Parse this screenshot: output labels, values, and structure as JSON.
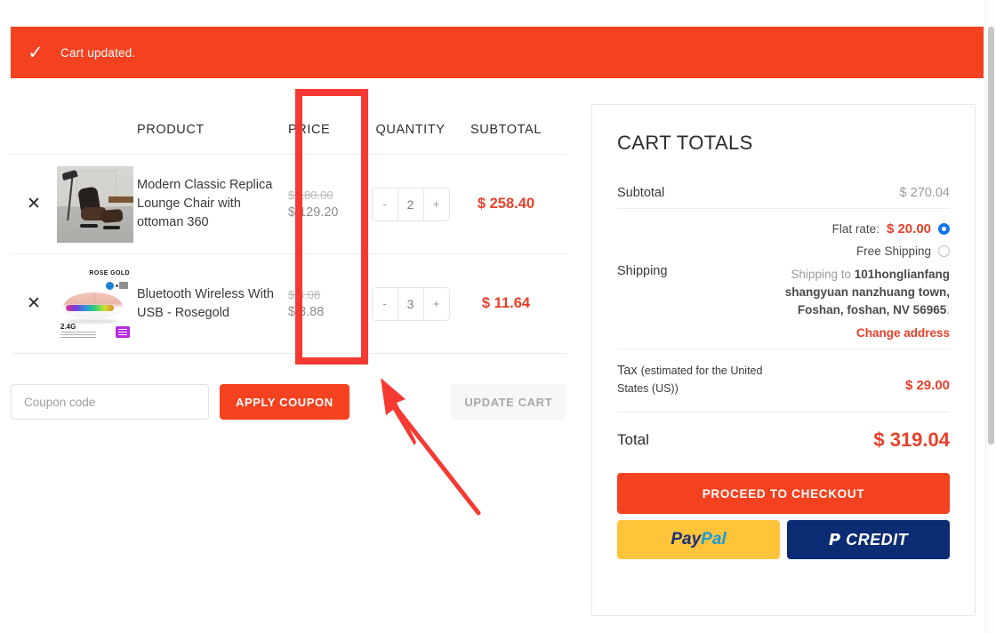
{
  "notice": {
    "icon": "check-icon",
    "text": "Cart updated."
  },
  "cart_table": {
    "headers": {
      "product": "PRODUCT",
      "price": "PRICE",
      "quantity": "QUANTITY",
      "subtotal": "SUBTOTAL"
    },
    "rows": [
      {
        "remove_icon": "close-icon",
        "thumb": "lounge-chair-photo",
        "name": "Modern Classic Replica Lounge Chair with ottoman 360",
        "price_old": "$ 180.00",
        "price_new": "$ 129.20",
        "qty_minus": "-",
        "qty": "2",
        "qty_plus": "+",
        "subtotal": "$ 258.40"
      },
      {
        "remove_icon": "close-icon",
        "thumb": "wireless-mouse-photo",
        "name": "Bluetooth Wireless With USB - Rosegold",
        "price_old": "$ 4.08",
        "price_new": "$ 3.88",
        "qty_minus": "-",
        "qty": "3",
        "qty_plus": "+",
        "subtotal": "$ 11.64"
      }
    ]
  },
  "coupon": {
    "placeholder": "Coupon code",
    "value": "",
    "apply_label": "APPLY COUPON",
    "update_label": "UPDATE CART"
  },
  "totals": {
    "title": "CART TOTALS",
    "subtotal_label": "Subtotal",
    "subtotal_value": "$ 270.04",
    "shipping_label": "Shipping",
    "shipping_options": [
      {
        "label": "Flat rate:",
        "amount": "$ 20.00",
        "selected": true
      },
      {
        "label": "Free Shipping",
        "amount": "",
        "selected": false
      }
    ],
    "shipping_to_prefix": "Shipping to ",
    "shipping_address": "101honglianfang shangyuan nanzhuang town, Foshan, foshan, NV 56965",
    "shipping_to_suffix": ".",
    "change_address_label": "Change address",
    "tax_label_main": "Tax ",
    "tax_label_note": "(estimated for the United States (US))",
    "tax_value": "$ 29.00",
    "total_label": "Total",
    "total_value": "$ 319.04",
    "checkout_label": "PROCEED TO CHECKOUT",
    "paypal_pay": "Pay",
    "paypal_pal": "Pal",
    "credit_mark": "P",
    "credit_label": "CREDIT"
  },
  "thumb_text": {
    "mouse_rose_gold": "ROSE GOLD",
    "mouse_24g": "2.4G"
  },
  "annotations": {
    "highlight_target": "price-column",
    "arrow_target": "price-column",
    "color": "#F43A32"
  },
  "colors": {
    "brand_red": "#F4411F",
    "accent_red": "#E8402A",
    "radio_blue": "#1473e6",
    "paypal_yellow": "#FFC43A",
    "paypal_navy": "#0B2C72"
  }
}
